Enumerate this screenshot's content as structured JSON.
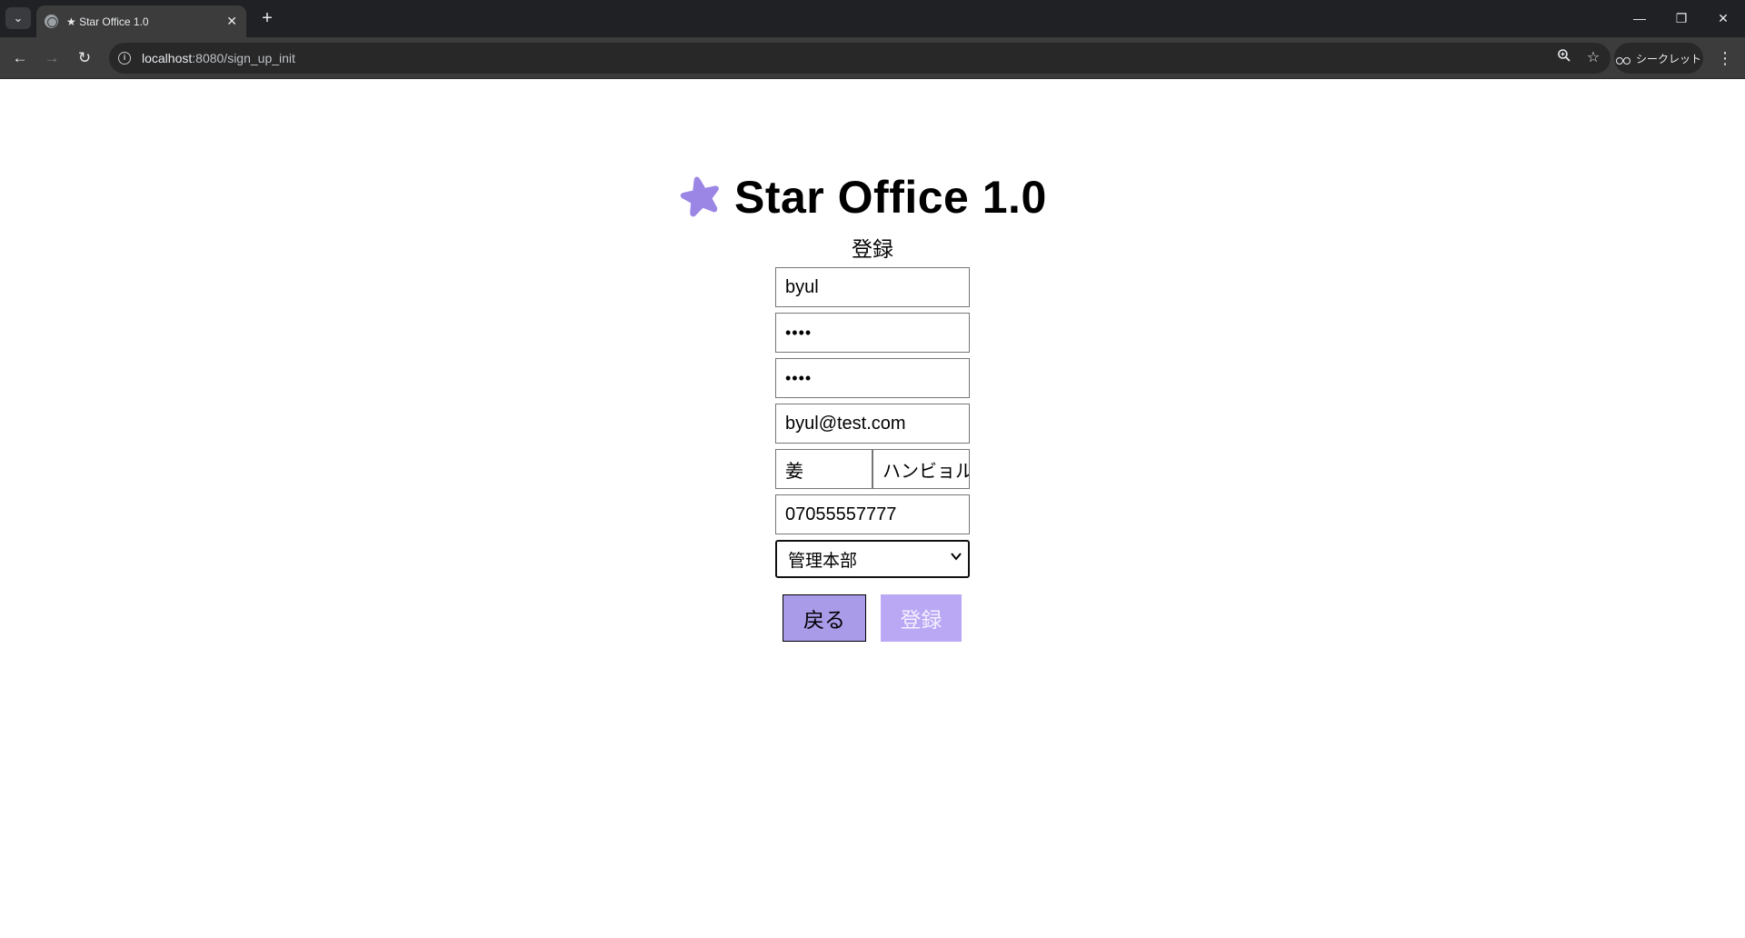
{
  "browser": {
    "tab_title": "★ Star Office 1.0",
    "url_host": "localhost",
    "url_path": ":8080/sign_up_init",
    "incognito_label": "シークレット"
  },
  "page": {
    "app_title": "Star Office 1.0",
    "form_title": "登録",
    "brand_color": "#9b86e6"
  },
  "form": {
    "user_id": "byul",
    "password": "••••",
    "password_confirm": "••••",
    "email": "byul@test.com",
    "last_name": "姜",
    "first_name": "ハンビョル",
    "phone": "07055557777",
    "department": "管理本部",
    "back_label": "戻る",
    "submit_label": "登録"
  }
}
